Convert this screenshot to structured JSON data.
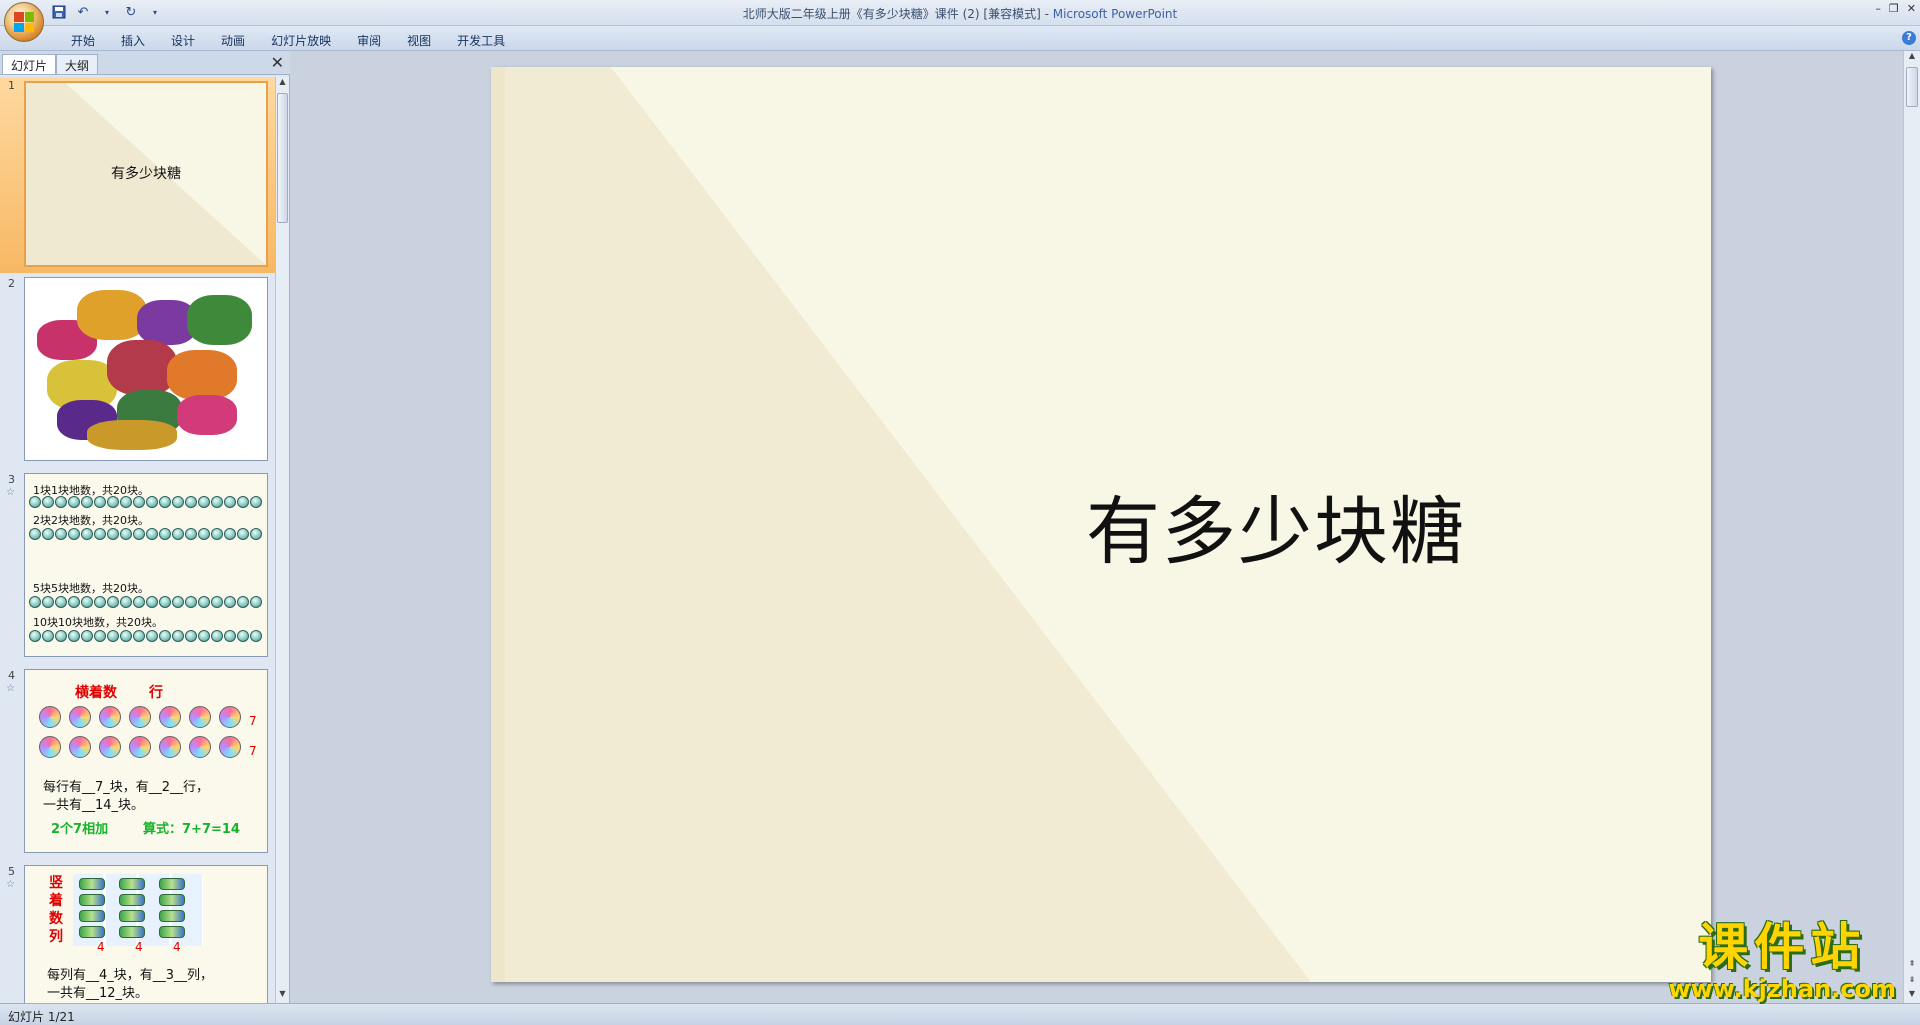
{
  "window": {
    "title_doc": "北师大版二年级上册《有多少块糖》课件 (2) [兼容模式]",
    "title_sep": " - ",
    "title_app": "Microsoft PowerPoint"
  },
  "quick_access": [
    "save-icon",
    "undo-icon",
    "redo-icon",
    "customize-icon"
  ],
  "ribbon": {
    "tabs": [
      "开始",
      "插入",
      "设计",
      "动画",
      "幻灯片放映",
      "审阅",
      "视图",
      "开发工具"
    ]
  },
  "left_pane": {
    "tabs": [
      "幻灯片",
      "大纲"
    ],
    "close_label": "✕"
  },
  "thumbnails": {
    "s1": {
      "num": "1",
      "title": "有多少块糖"
    },
    "s2": {
      "num": "2"
    },
    "s3": {
      "num": "3",
      "lines": [
        "1块1块地数，共20块。",
        "2块2块地数，共20块。",
        "5块5块地数，共20块。",
        "10块10块地数，共20块。"
      ]
    },
    "s4": {
      "num": "4",
      "heading_a": "横着数",
      "heading_b": "行",
      "row_count_1": "7",
      "row_count_2": "7",
      "sentence_1": "每行有__7_块，有__2__行，",
      "sentence_2": "一共有__14_块。",
      "note": "2个7相加",
      "formula": "算式：7+7=14"
    },
    "s5": {
      "num": "5",
      "vertical": "竖着数列",
      "col_counts": [
        "4",
        "4",
        "4"
      ],
      "sentence_1": "每列有__4_块，有__3__列，",
      "sentence_2": "一共有__12_块。"
    }
  },
  "slide": {
    "title": "有多少块糖"
  },
  "status": {
    "text": "幻灯片 1/21"
  },
  "watermark": {
    "main": "课件站",
    "url": "www.kjzhan.com"
  }
}
